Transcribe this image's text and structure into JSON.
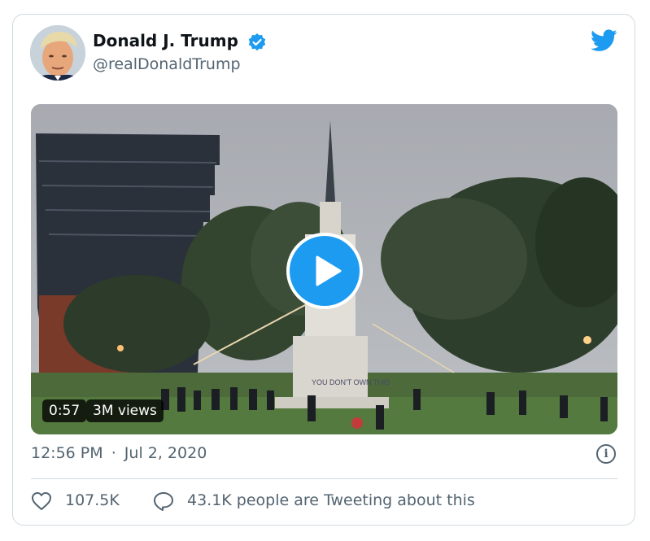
{
  "tweet": {
    "author_name": "Donald J. Trump",
    "author_handle": "@realDonaldTrump",
    "verified": true,
    "media": {
      "type": "video",
      "duration": "0:57",
      "views": "3M views",
      "graffiti_text": "YOU DON'T OWN THIS"
    },
    "timestamp": {
      "time": "12:56 PM",
      "separator": "·",
      "date": "Jul 2, 2020"
    },
    "actions": {
      "likes": "107.5K",
      "talking": "43.1K people are Tweeting about this"
    }
  },
  "icons": {
    "logo": "twitter-bird-icon",
    "verified": "verified-badge-icon",
    "play": "play-icon",
    "info": "info-icon",
    "like": "heart-icon",
    "reply": "speech-bubble-icon"
  },
  "colors": {
    "accent": "#1d9bf0",
    "text_primary": "#0f1419",
    "text_secondary": "#536471",
    "border": "#cfd9de"
  }
}
